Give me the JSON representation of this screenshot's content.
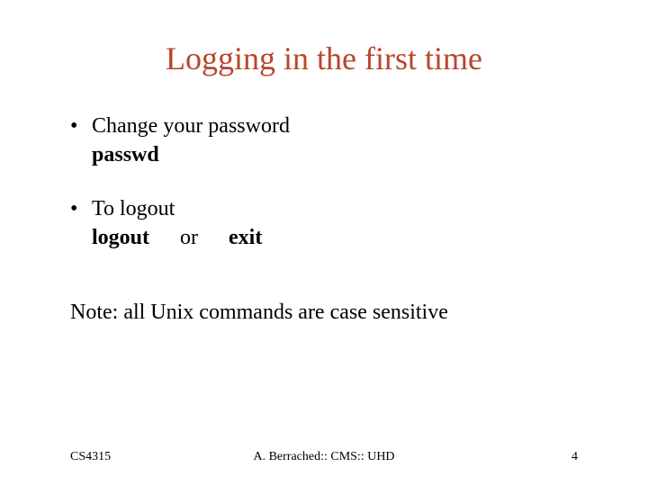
{
  "title": "Logging in the first time",
  "bullets": [
    {
      "text": "Change your password",
      "sub": "passwd"
    },
    {
      "text": "To logout",
      "cmds": {
        "a": "logout",
        "sep": "or",
        "b": "exit"
      }
    }
  ],
  "note": "Note: all Unix commands are case sensitive",
  "footer": {
    "left": "CS4315",
    "center": "A. Berrached:: CMS:: UHD",
    "page": "4"
  }
}
